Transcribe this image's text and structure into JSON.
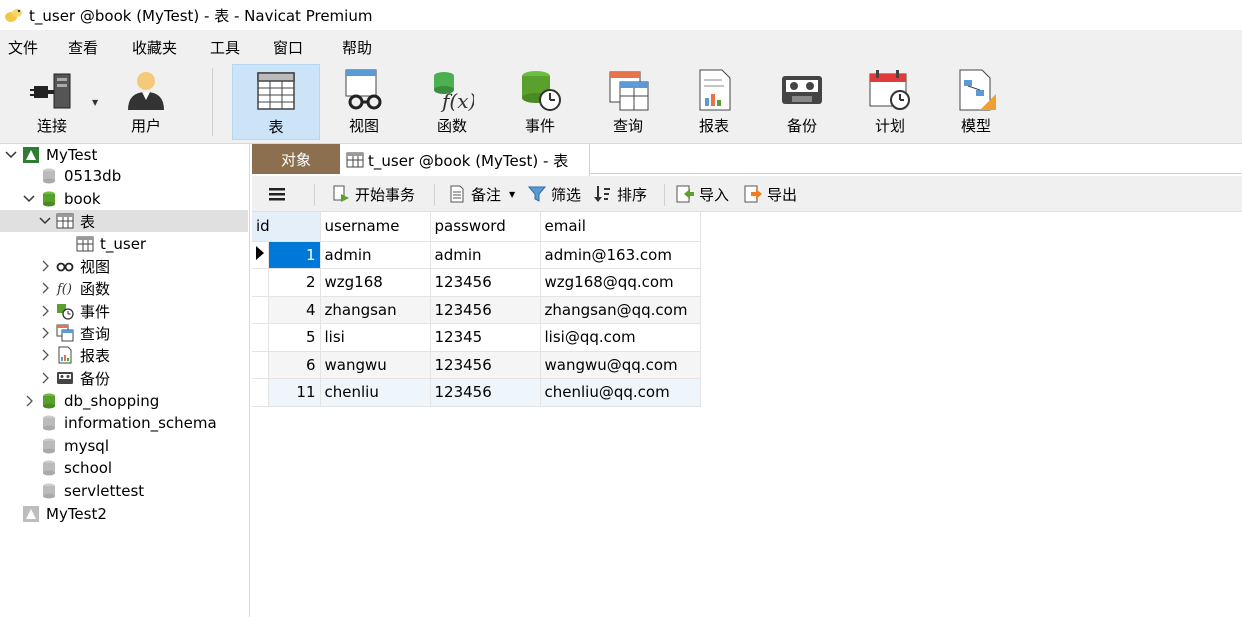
{
  "window": {
    "title": "t_user @book (MyTest) - 表 - Navicat Premium"
  },
  "menu": [
    "文件",
    "查看",
    "收藏夹",
    "工具",
    "窗口",
    "帮助"
  ],
  "toolbar": {
    "connect": "连接",
    "user": "用户",
    "table": "表",
    "view": "视图",
    "function": "函数",
    "event": "事件",
    "query": "查询",
    "report": "报表",
    "backup": "备份",
    "schedule": "计划",
    "model": "模型"
  },
  "sidebar": {
    "connection1": "MyTest",
    "databases": [
      "0513db",
      "book"
    ],
    "book_children": {
      "tables": "表",
      "table_items": [
        "t_user"
      ],
      "views": "视图",
      "functions": "函数",
      "events": "事件",
      "queries": "查询",
      "reports": "报表",
      "backups": "备份"
    },
    "other_databases": [
      "db_shopping",
      "information_schema",
      "mysql",
      "school",
      "servlettest"
    ],
    "connection2": "MyTest2"
  },
  "tabs": {
    "objects": "对象",
    "table_tab": "t_user @book (MyTest) - 表"
  },
  "subtoolbar": {
    "begin_transaction": "开始事务",
    "memo": "备注",
    "filter": "筛选",
    "sort": "排序",
    "import": "导入",
    "export": "导出"
  },
  "grid": {
    "columns": [
      "id",
      "username",
      "password",
      "email"
    ],
    "rows": [
      [
        "1",
        "admin",
        "admin",
        "admin@163.com"
      ],
      [
        "2",
        "wzg168",
        "123456",
        "wzg168@qq.com"
      ],
      [
        "4",
        "zhangsan",
        "123456",
        "zhangsan@qq.com"
      ],
      [
        "5",
        "lisi",
        "12345",
        "lisi@qq.com"
      ],
      [
        "6",
        "wangwu",
        "123456",
        "wangwu@qq.com"
      ],
      [
        "11",
        "chenliu",
        "123456",
        "chenliu@qq.com"
      ]
    ]
  },
  "colors": {
    "accent": "#0078d7",
    "objects_tab": "#8b6f4e",
    "db_green": "#5aa02c",
    "toolbar_active": "#cce4f7"
  }
}
